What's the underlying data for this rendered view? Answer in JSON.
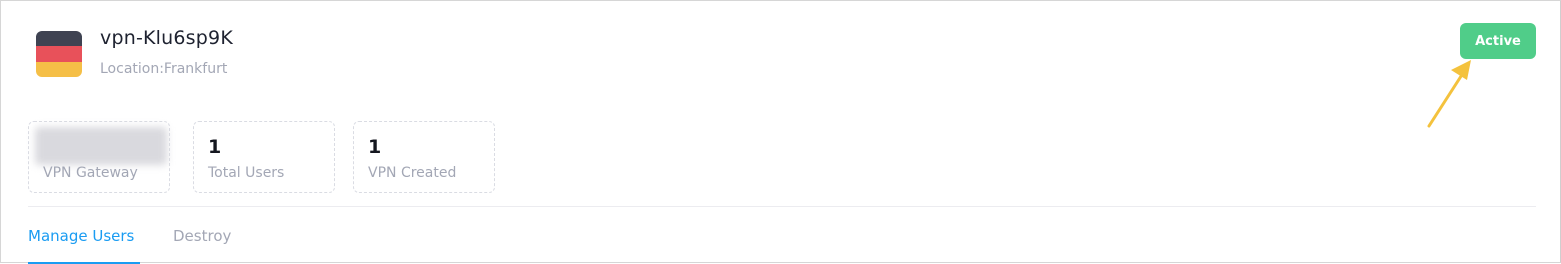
{
  "header": {
    "title": "vpn-Klu6sp9K",
    "location": "Location:Frankfurt",
    "flag_icon": "germany-flag-icon",
    "flag_colors": [
      "#3f4352",
      "#e8515a",
      "#f5bf47"
    ]
  },
  "status": {
    "label": "Active",
    "color": "#50cd89"
  },
  "annotation": {
    "arrow_color": "#f4c23d"
  },
  "stats": [
    {
      "value": "",
      "label": "VPN Gateway",
      "redacted": true,
      "redact_color": "#d9d9de"
    },
    {
      "value": "1",
      "label": "Total Users"
    },
    {
      "value": "1",
      "label": "VPN Created"
    }
  ],
  "tabs": [
    {
      "label": "Manage Users",
      "active": true
    },
    {
      "label": "Destroy",
      "active": false
    }
  ],
  "colors": {
    "accent": "#1a9cf2",
    "muted": "#a3a7b5"
  }
}
